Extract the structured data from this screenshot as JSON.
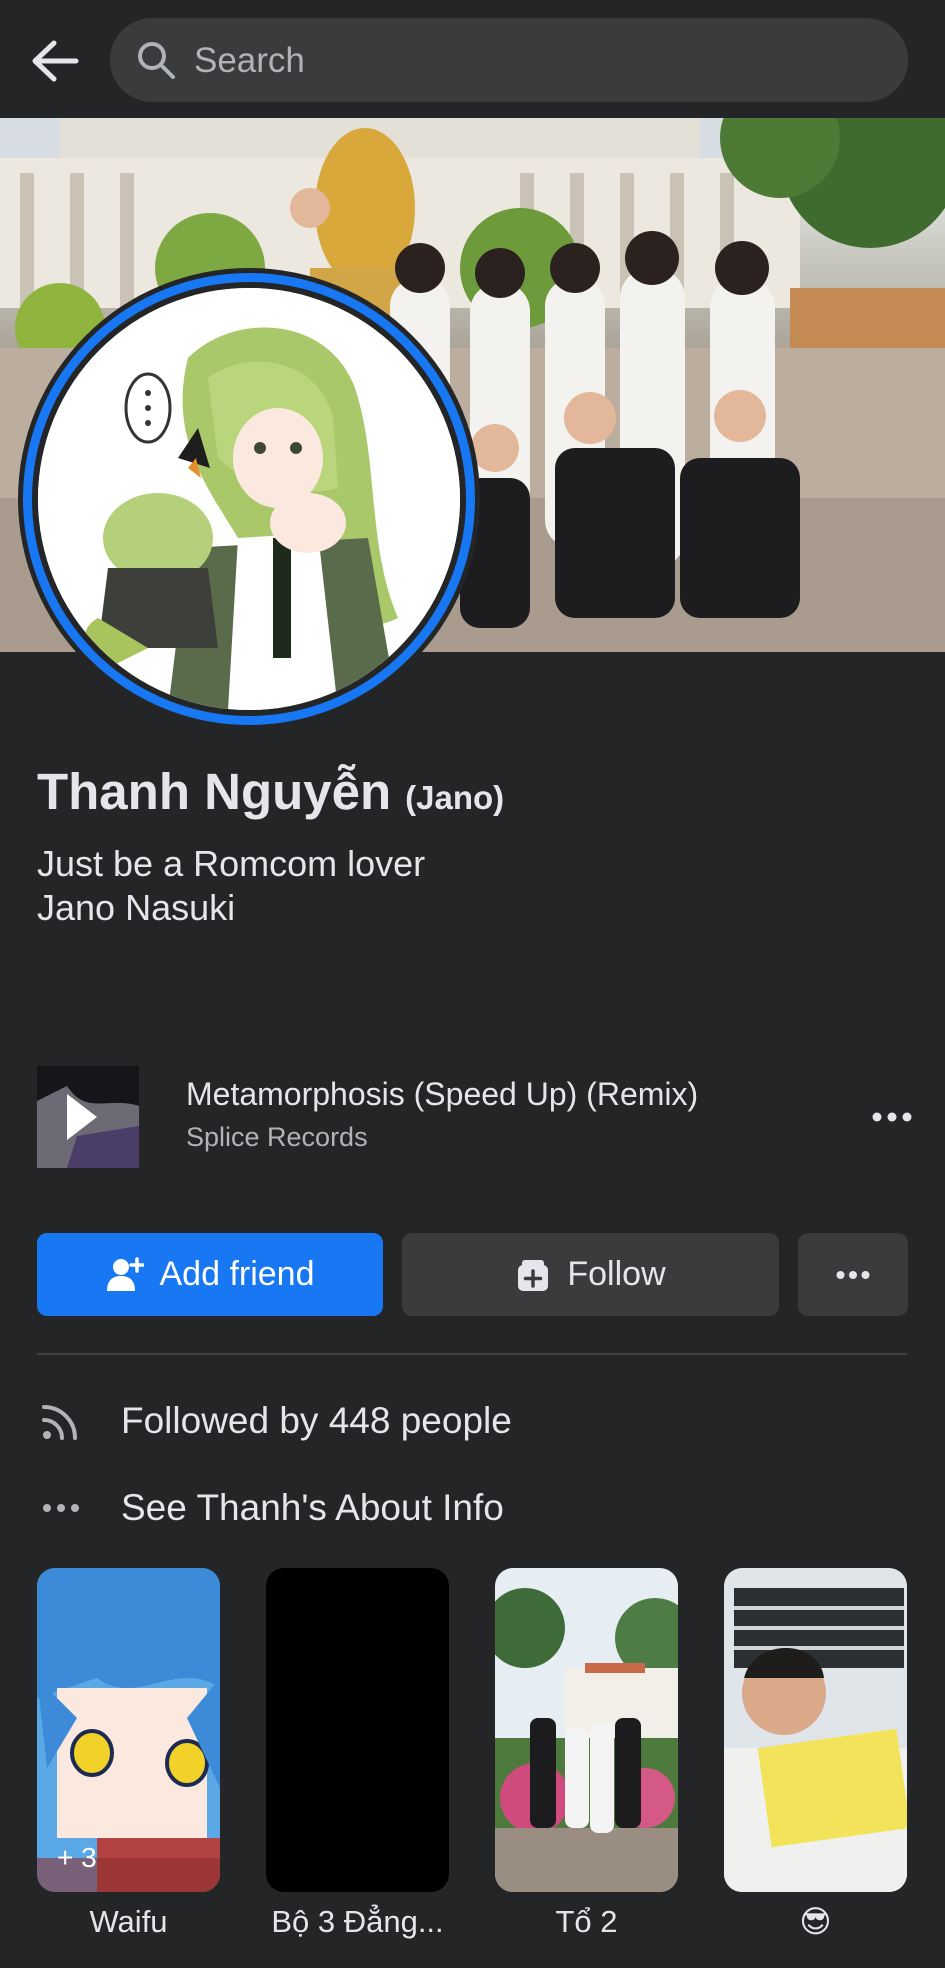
{
  "header": {
    "back_icon": "arrow-left-icon",
    "search_placeholder": "Search",
    "search_icon": "search-icon"
  },
  "profile": {
    "name": "Thanh Nguyễn",
    "alternate_name": "(Jano)",
    "bio_line1": "Just be a Romcom lover",
    "bio_line2": "Jano Nasuki",
    "avatar_ring_color": "#1877f2"
  },
  "music": {
    "title": "Metamorphosis (Speed Up) (Remix)",
    "artist": "Splice Records",
    "play_icon": "play-icon",
    "more_icon": "more-horizontal-icon"
  },
  "actions": {
    "add_friend_label": "Add friend",
    "add_friend_icon": "add-person-icon",
    "follow_label": "Follow",
    "follow_icon": "follow-icon",
    "more_icon": "more-horizontal-icon",
    "primary_color": "#1877f2"
  },
  "info": {
    "followers_text": "Followed by 448 people",
    "followers_icon": "rss-feed-icon",
    "about_text": "See Thanh's About Info",
    "about_icon": "more-horizontal-icon"
  },
  "featured": [
    {
      "label": "Waifu",
      "extra": "+ 3"
    },
    {
      "label": "Bộ 3 Đẳng..."
    },
    {
      "label": "Tổ 2"
    },
    {
      "label": "😎"
    }
  ]
}
